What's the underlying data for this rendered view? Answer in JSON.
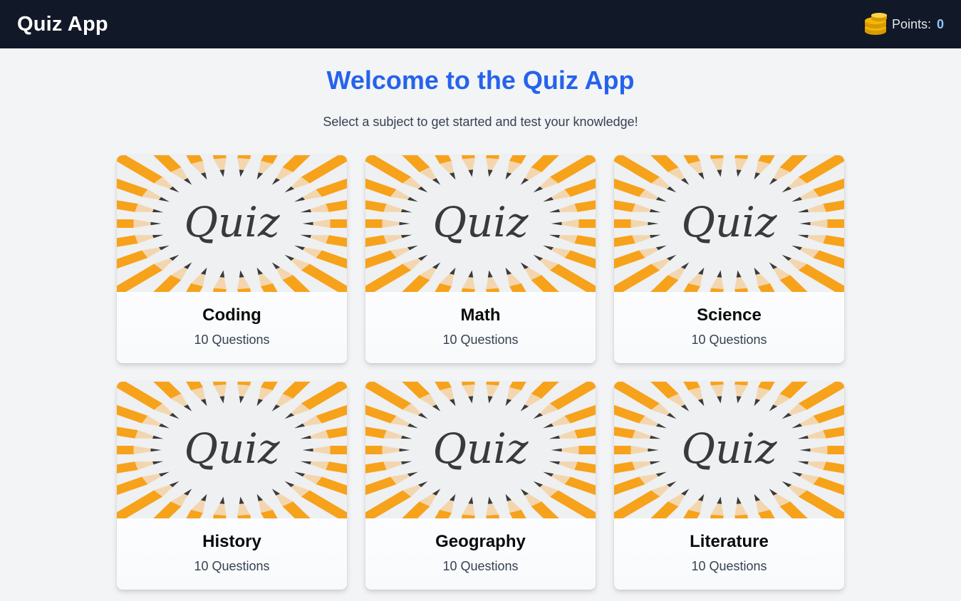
{
  "navbar": {
    "brand": "Quiz App",
    "points_label": "Points:",
    "points_value": "0",
    "points_icon": "coins-icon"
  },
  "main": {
    "title": "Welcome to the Quiz App",
    "subtitle": "Select a subject to get started and test your knowledge!"
  },
  "subjects": [
    {
      "name": "Coding",
      "count": "10 Questions"
    },
    {
      "name": "Math",
      "count": "10 Questions"
    },
    {
      "name": "Science",
      "count": "10 Questions"
    },
    {
      "name": "History",
      "count": "10 Questions"
    },
    {
      "name": "Geography",
      "count": "10 Questions"
    },
    {
      "name": "Literature",
      "count": "10 Questions"
    }
  ],
  "card_image_text": "Quiz",
  "colors": {
    "navbar_bg": "#111827",
    "accent": "#2563eb",
    "page_bg": "#f3f4f6",
    "pencil": "#f7a21b",
    "coin": "#f2b705"
  }
}
